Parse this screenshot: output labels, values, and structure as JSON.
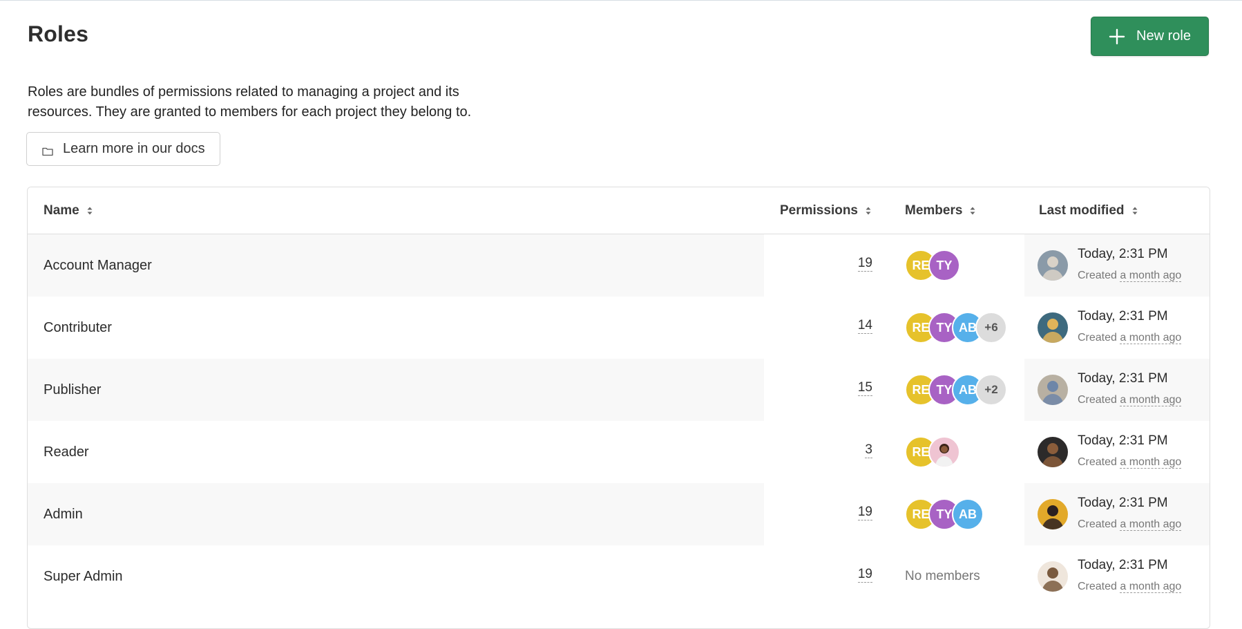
{
  "page": {
    "title": "Roles",
    "new_role_label": "New role",
    "description_line1": "Roles are bundles of permissions related to managing a project and its",
    "description_line2": "resources. They are granted to members for each project they belong to.",
    "docs_label": "Learn more in our docs"
  },
  "table": {
    "headers": {
      "name": "Name",
      "permissions": "Permissions",
      "members": "Members",
      "last_modified": "Last modified"
    },
    "rows": [
      {
        "name": "Account Manager",
        "permissions": "19",
        "members": [
          {
            "initials": "RE",
            "color": "#e6c22b"
          },
          {
            "initials": "TY",
            "color": "#a862c4"
          }
        ],
        "no_members": "",
        "modified": "Today, 2:31 PM",
        "created_prefix": "Created",
        "created_ago": "a month ago",
        "modifier_colors": [
          "#8a9aa8",
          "#d9d2c8"
        ]
      },
      {
        "name": "Contributer",
        "permissions": "14",
        "members": [
          {
            "initials": "RE",
            "color": "#e6c22b"
          },
          {
            "initials": "TY",
            "color": "#a862c4"
          },
          {
            "initials": "AB",
            "color": "#56b0ea"
          },
          {
            "initials": "+6",
            "color": "#dcdcdc",
            "more": true
          }
        ],
        "no_members": "",
        "modified": "Today, 2:31 PM",
        "created_prefix": "Created",
        "created_ago": "a month ago",
        "modifier_colors": [
          "#3e6a7e",
          "#e0b45a"
        ]
      },
      {
        "name": "Publisher",
        "permissions": "15",
        "members": [
          {
            "initials": "RE",
            "color": "#e6c22b"
          },
          {
            "initials": "TY",
            "color": "#a862c4"
          },
          {
            "initials": "AB",
            "color": "#56b0ea"
          },
          {
            "initials": "+2",
            "color": "#dcdcdc",
            "more": true
          }
        ],
        "no_members": "",
        "modified": "Today, 2:31 PM",
        "created_prefix": "Created",
        "created_ago": "a month ago",
        "modifier_colors": [
          "#b8b0a2",
          "#6e86a8"
        ]
      },
      {
        "name": "Reader",
        "permissions": "3",
        "members": [
          {
            "initials": "RE",
            "color": "#e6c22b"
          },
          {
            "initials": "",
            "color": "#efc4d2",
            "photo": true
          }
        ],
        "no_members": "",
        "modified": "Today, 2:31 PM",
        "created_prefix": "Created",
        "created_ago": "a month ago",
        "modifier_colors": [
          "#2c2a2a",
          "#8b5d3b"
        ]
      },
      {
        "name": "Admin",
        "permissions": "19",
        "members": [
          {
            "initials": "RE",
            "color": "#e6c22b"
          },
          {
            "initials": "TY",
            "color": "#a862c4"
          },
          {
            "initials": "AB",
            "color": "#56b0ea"
          }
        ],
        "no_members": "",
        "modified": "Today, 2:31 PM",
        "created_prefix": "Created",
        "created_ago": "a month ago",
        "modifier_colors": [
          "#e2a92a",
          "#2b2020"
        ]
      },
      {
        "name": "Super Admin",
        "permissions": "19",
        "members": [],
        "no_members": "No members",
        "modified": "Today, 2:31 PM",
        "created_prefix": "Created",
        "created_ago": "a month ago",
        "modifier_colors": [
          "#efe6dc",
          "#7a5a3e"
        ]
      }
    ]
  },
  "colors": {
    "accent": "#2f8f5b",
    "stripe": "#f8f8f8"
  }
}
